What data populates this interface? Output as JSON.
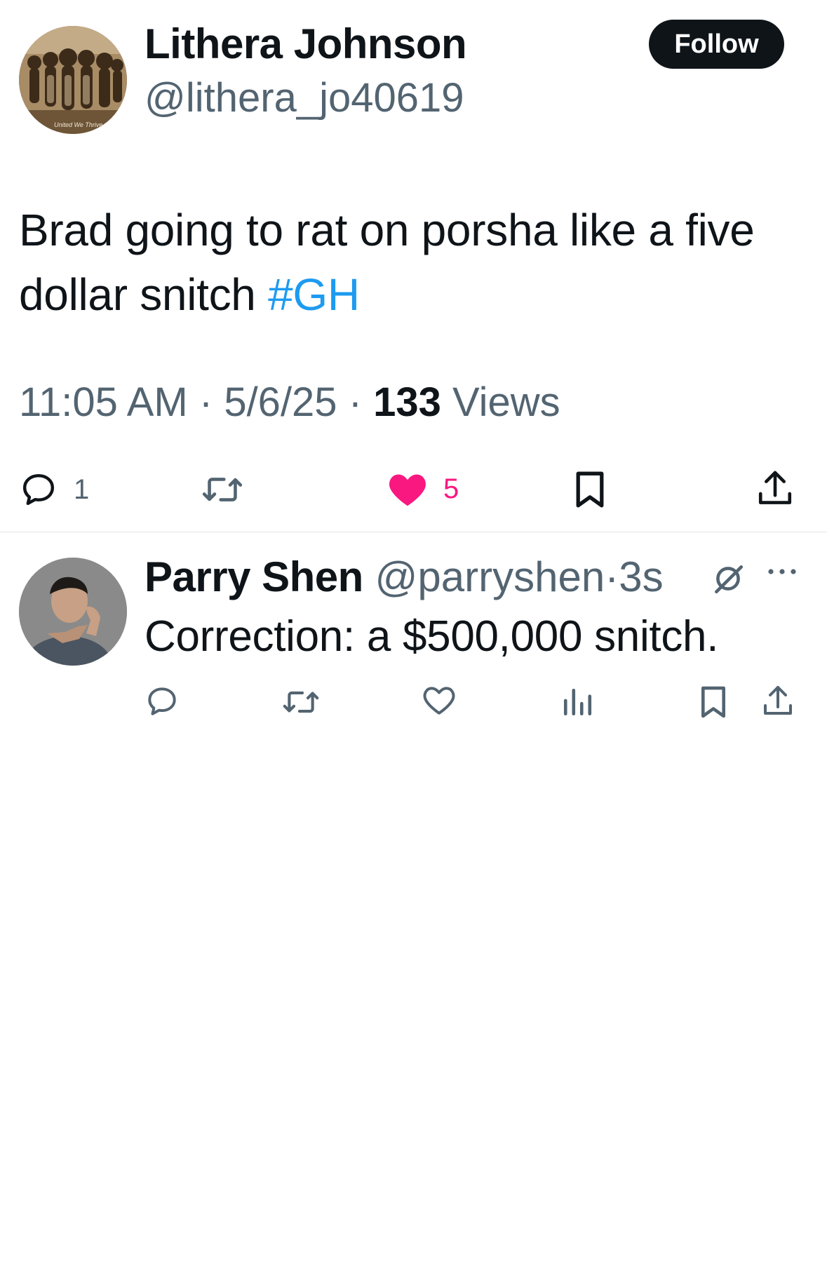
{
  "tweet": {
    "author": {
      "name": "Lithera Johnson",
      "handle": "@lithera_jo40619",
      "avatar_caption": "United We Thrive"
    },
    "follow_label": "Follow",
    "text": "Brad going to rat on porsha like a five dollar snitch ",
    "hashtag": "#GH",
    "time": "11:05 AM",
    "date": "5/6/25",
    "sep": " · ",
    "views_count": "133",
    "views_label": " Views",
    "actions": {
      "reply_count": "1",
      "like_count": "5"
    }
  },
  "reply": {
    "name": "Parry Shen",
    "handle": "@parryshen",
    "sep": "·",
    "time": "3s",
    "text": "Correction: a $500,000 snitch."
  },
  "colors": {
    "text_primary": "#0f1419",
    "text_secondary": "#536471",
    "link": "#1d9bf0",
    "like_active": "#f91880",
    "follow_bg": "#0f1419",
    "divider": "#e1e6ea"
  },
  "icons": {
    "reply": "speech-bubble-icon",
    "retweet": "retweet-arrows-icon",
    "like_filled": "heart-filled-icon",
    "like": "heart-outline-icon",
    "bookmark": "bookmark-icon",
    "share": "share-upload-icon",
    "views": "bar-chart-icon",
    "grok": "grok-slash-icon",
    "more": "ellipsis-icon"
  }
}
